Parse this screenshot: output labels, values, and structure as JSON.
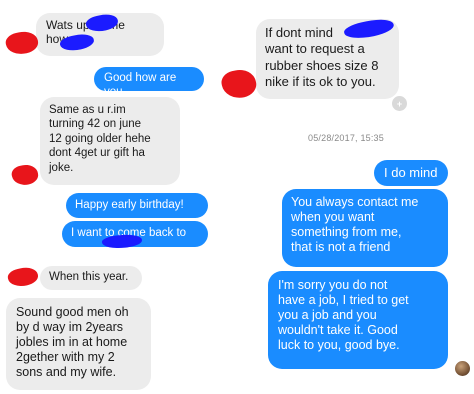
{
  "thread": {
    "timestamp": "05/28/2017, 15:35",
    "messages": [
      {
        "id": "m1",
        "from": "other",
        "text": "Wats up       its me\n           how r u."
      },
      {
        "id": "m2",
        "from": "me",
        "text": "Good how are you"
      },
      {
        "id": "m3",
        "from": "other",
        "text": "Same as u r.im\nturning 42 on june\n12 going older hehe\ndont 4get ur gift ha\njoke."
      },
      {
        "id": "m4",
        "from": "me",
        "text": "Happy early birthday!"
      },
      {
        "id": "m5",
        "from": "me",
        "text": "I want to come back to"
      },
      {
        "id": "m6",
        "from": "other",
        "text": "When this year."
      },
      {
        "id": "m7",
        "from": "other",
        "text": "Sound good men oh\nby d way im 2years\njobles im in at home\n2gether with my 2\nsons and my wife."
      },
      {
        "id": "m8",
        "from": "other",
        "text": "If dont mind\nwant to request a\nrubber shoes size 8\nnike if its ok to you."
      },
      {
        "id": "m9",
        "from": "me",
        "text": "I do mind"
      },
      {
        "id": "m10",
        "from": "me",
        "text": "You always contact me\nwhen you want\nsomething from me,\nthat is not a friend"
      },
      {
        "id": "m11",
        "from": "me",
        "text": "I'm sorry you do not\nhave a job, I tried to get\nyou a job and you\nwouldn't take it. Good\nluck to you, good bye."
      }
    ],
    "reaction_icon": "add-reaction-icon",
    "reaction_glyph": "+",
    "avatar_icon": "contact-avatar"
  },
  "colors": {
    "incoming_bubble": "#ececec",
    "outgoing_bubble": "#1a8cff",
    "redaction_blue": "#1b1bff",
    "redaction_red": "#e8151b"
  }
}
